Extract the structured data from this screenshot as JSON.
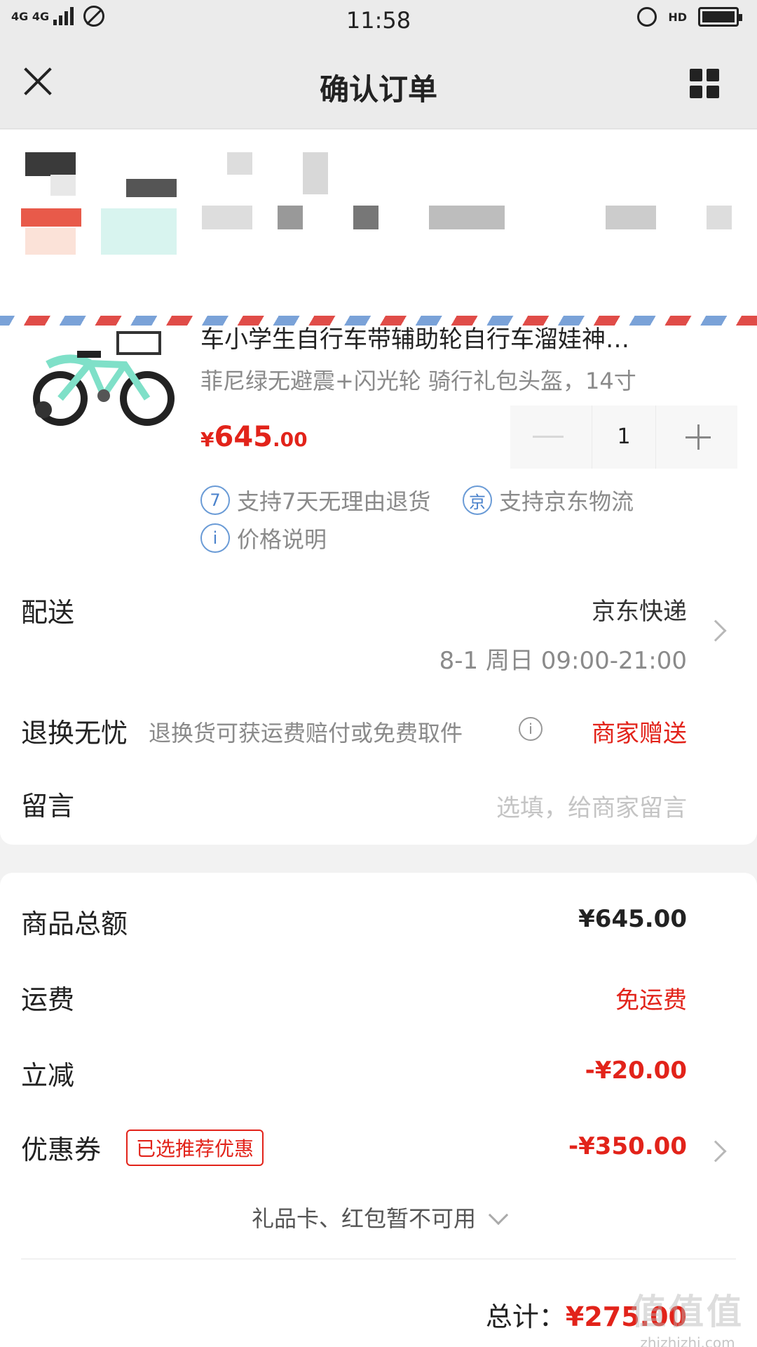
{
  "status_bar": {
    "network": "4G 4G",
    "time": "11:58",
    "hd": "HD"
  },
  "nav": {
    "title": "确认订单"
  },
  "product": {
    "title": "车小学生自行车带辅助轮自行车溜娃神…",
    "spec": "菲尼绿无避震+闪光轮 骑行礼包头盔，14寸",
    "price_symbol": "¥",
    "price_int": "645",
    "price_dec": ".00",
    "quantity": "1",
    "tags": [
      {
        "icon": "7",
        "label": "支持7天无理由退货"
      },
      {
        "icon": "京",
        "label": "支持京东物流"
      },
      {
        "icon": "i",
        "label": "价格说明"
      }
    ]
  },
  "delivery": {
    "label": "配送",
    "method": "京东快递",
    "time": "8-1 周日 09:00-21:00"
  },
  "return_worry": {
    "label": "退换无忧",
    "desc": "退换货可获运费赔付或免费取件",
    "value": "商家赠送"
  },
  "message": {
    "label": "留言",
    "placeholder": "选填，给商家留言"
  },
  "summary": {
    "goods_total_label": "商品总额",
    "goods_total_value": "¥645.00",
    "shipping_label": "运费",
    "shipping_value": "免运费",
    "discount_label": "立减",
    "discount_value": "-¥20.00",
    "coupon_label": "优惠券",
    "coupon_badge": "已选推荐优惠",
    "coupon_value": "-¥350.00",
    "gift_card_note": "礼品卡、红包暂不可用",
    "total_label": "总计：",
    "total_value": "¥275.00"
  },
  "watermark": {
    "brand": "值值值",
    "url": "zhizhizhi.com"
  },
  "colors": {
    "accent_red": "#e2231a",
    "tag_blue": "#4a82cc",
    "bike_green": "#7fe0c8"
  }
}
